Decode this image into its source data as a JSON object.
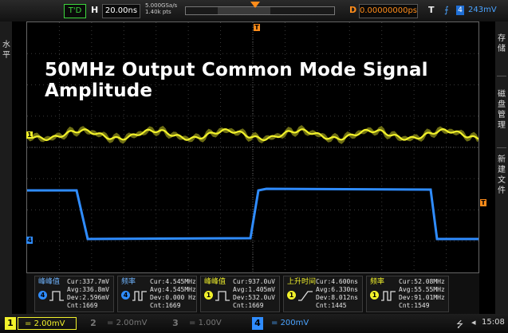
{
  "topbar": {
    "trigger_status": "T'D",
    "horizontal_label": "H",
    "timebase": "20.00ns",
    "sample_rate": "5.000GSa/s",
    "memory_depth": "1.40k pts",
    "delay_label": "D",
    "delay_value": "0.00000000ps",
    "trigger_label": "T",
    "trigger_source": "4",
    "trigger_level": "243mV"
  },
  "side_left": {
    "chars": [
      "水",
      "平"
    ]
  },
  "side_right": {
    "group1": [
      "存",
      "储"
    ],
    "group2": [
      "磁",
      "盘",
      "管",
      "理"
    ],
    "group3": [
      "新",
      "建",
      "文",
      "件"
    ]
  },
  "screen": {
    "title": "50MHz Output Common Mode Signal Amplitude",
    "ch1_marker": "1",
    "ch4_marker": "4",
    "trigger_marker": "T"
  },
  "measurements": [
    {
      "name": "峰峰值",
      "channel": "4",
      "cur": "Cur:337.7mV",
      "avg": "Avg:336.8mV",
      "dev": "Dev:2.596mV",
      "cnt": "Cnt:1669"
    },
    {
      "name": "频率",
      "channel": "4",
      "cur": "Cur:4.545MHz",
      "avg": "Avg:4.545MHz",
      "dev": "Dev:0.000 Hz",
      "cnt": "Cnt:1669"
    },
    {
      "name": "峰峰值",
      "channel": "1",
      "cur": "Cur:937.0uV",
      "avg": "Avg:1.405mV",
      "dev": "Dev:532.0uV",
      "cnt": "Cnt:1669"
    },
    {
      "name": "上升时间",
      "channel": "1",
      "cur": "Cur:4.600ns",
      "avg": "Avg:6.330ns",
      "dev": "Dev:8.012ns",
      "cnt": "Cnt:1445"
    },
    {
      "name": "频率",
      "channel": "1",
      "cur": "Cur:52.08MHz",
      "avg": "Avg:55.55MHz",
      "dev": "Dev:91.01MHz",
      "cnt": "Cnt:1549"
    }
  ],
  "channels": [
    {
      "num": "1",
      "scale": "2.00mV",
      "active": true
    },
    {
      "num": "2",
      "scale": "2.00mV",
      "active": false
    },
    {
      "num": "3",
      "scale": "1.00V",
      "active": false
    },
    {
      "num": "4",
      "scale": "200mV",
      "active": true
    }
  ],
  "clock": "15:08",
  "colors": {
    "ch1": "#f2f22b",
    "ch4": "#2f8cff",
    "trigger": "#ff8c1a",
    "td": "#3dd63d"
  },
  "icons": [
    "usb-icon",
    "sound-icon",
    "trigger-edge-icon"
  ]
}
